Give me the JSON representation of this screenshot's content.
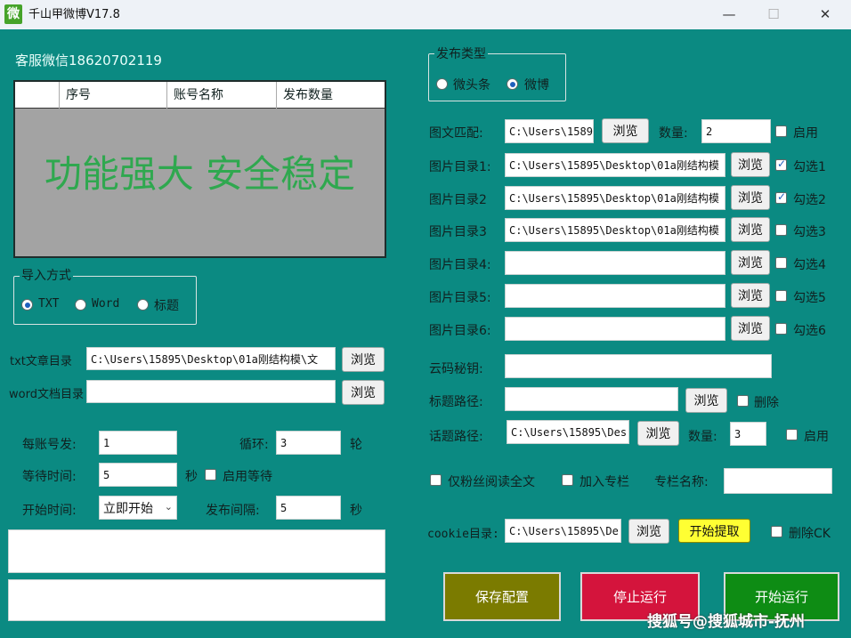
{
  "window": {
    "title": "千山甲微博V17.8",
    "icon_char": "微",
    "minimize": "—",
    "maximize": "☐",
    "close": "✕"
  },
  "service_contact": "客服微信18620702119",
  "account_table": {
    "columns": [
      "",
      "序号",
      "账号名称",
      "发布数量"
    ],
    "watermark": "功能强大 安全稳定"
  },
  "import_group": {
    "title": "导入方式",
    "options": [
      {
        "label": "TXT",
        "selected": true
      },
      {
        "label": "Word",
        "selected": false
      },
      {
        "label": "标题",
        "selected": false
      }
    ]
  },
  "txt_dir": {
    "label": "txt文章目录",
    "value": "C:\\Users\\15895\\Desktop\\01a刚结构模\\文",
    "button": "浏览"
  },
  "word_dir": {
    "label": "word文档目录",
    "value": "",
    "button": "浏览"
  },
  "settings": {
    "per_account_label": "每账号发:",
    "per_account_value": "1",
    "loop_label": "循环:",
    "loop_value": "3",
    "loop_unit": "轮",
    "wait_label": "等待时间:",
    "wait_value": "5",
    "wait_unit": "秒",
    "enable_wait_label": "启用等待",
    "start_label": "开始时间:",
    "start_value": "立即开始",
    "interval_label": "发布间隔:",
    "interval_value": "5",
    "interval_unit": "秒"
  },
  "publish_type": {
    "title": "发布类型",
    "options": [
      {
        "label": "微头条",
        "selected": false
      },
      {
        "label": "微博",
        "selected": true
      }
    ]
  },
  "image_match": {
    "label": "图文匹配:",
    "value": "C:\\Users\\1589",
    "button": "浏览",
    "count_label": "数量:",
    "count_value": "2",
    "enable_label": "启用"
  },
  "image_dirs": [
    {
      "label": "图片目录1:",
      "value": "C:\\Users\\15895\\Desktop\\01a刚结构模",
      "button": "浏览",
      "check_label": "勾选1",
      "checked": true
    },
    {
      "label": "图片目录2",
      "value": "C:\\Users\\15895\\Desktop\\01a刚结构模",
      "button": "浏览",
      "check_label": "勾选2",
      "checked": true
    },
    {
      "label": "图片目录3",
      "value": "C:\\Users\\15895\\Desktop\\01a刚结构模",
      "button": "浏览",
      "check_label": "勾选3",
      "checked": false
    },
    {
      "label": "图片目录4:",
      "value": "",
      "button": "浏览",
      "check_label": "勾选4",
      "checked": false
    },
    {
      "label": "图片目录5:",
      "value": "",
      "button": "浏览",
      "check_label": "勾选5",
      "checked": false
    },
    {
      "label": "图片目录6:",
      "value": "",
      "button": "浏览",
      "check_label": "勾选6",
      "checked": false
    }
  ],
  "cloud_key": {
    "label": "云码秘钥:",
    "value": ""
  },
  "title_path": {
    "label": "标题路径:",
    "value": "",
    "button": "浏览",
    "delete_label": "删除"
  },
  "topic_path": {
    "label": "话题路径:",
    "value": "C:\\Users\\15895\\Des",
    "button": "浏览",
    "count_label": "数量:",
    "count_value": "3",
    "enable_label": "启用"
  },
  "options_row": {
    "fans_only_label": "仅粉丝阅读全文",
    "add_column_label": "加入专栏",
    "column_name_label": "专栏名称:",
    "column_name_value": ""
  },
  "cookie": {
    "label": "cookie目录:",
    "value": "C:\\Users\\15895\\De",
    "browse": "浏览",
    "extract": "开始提取",
    "delete_label": "删除CK"
  },
  "actions": {
    "save": "保存配置",
    "stop": "停止运行",
    "start": "开始运行"
  },
  "watermark_text": "搜狐号@搜狐城市-抚州",
  "colors": {
    "background": "#0b8a82",
    "save": "#7b7b00",
    "stop": "#d4143c",
    "start": "#0e8c14",
    "extract": "#ffff33",
    "table_watermark": "#2fa84f"
  }
}
